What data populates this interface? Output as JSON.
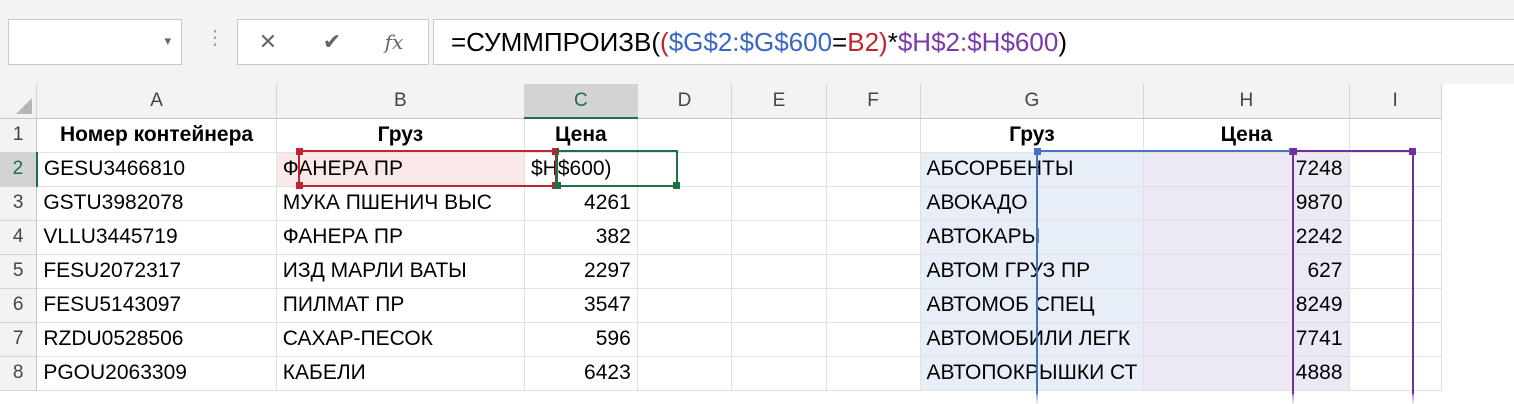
{
  "name_box": {
    "value": "",
    "dropdown_icon": "chevron-down-icon"
  },
  "formula_bar": {
    "cancel_icon": "✕",
    "enter_icon": "✔",
    "fx_label": "fx",
    "formula": {
      "p1": "=СУММПРОИЗВ(",
      "p2": "(",
      "p3": "$G$2:$G$600",
      "p4": "=",
      "p5": "B2",
      "p6": ")",
      "p7": "*",
      "p8": "$H$2:$H$600",
      "p9": ")"
    }
  },
  "columns": [
    "A",
    "B",
    "C",
    "D",
    "E",
    "F",
    "G",
    "H",
    "I"
  ],
  "rows": [
    {
      "num": "1",
      "a": "Номер контейнера",
      "b": "Груз",
      "c": "Цена",
      "g": "Груз",
      "h": "Цена"
    },
    {
      "num": "2",
      "a": "GESU3466810",
      "b": "ФАНЕРА ПР",
      "c": "$H$600)",
      "g": "АБСОРБЕНТЫ",
      "h": "7248"
    },
    {
      "num": "3",
      "a": "GSTU3982078",
      "b": "МУКА ПШЕНИЧ ВЫС",
      "c": "4261",
      "g": "АВОКАДО",
      "h": "9870"
    },
    {
      "num": "4",
      "a": "VLLU3445719",
      "b": "ФАНЕРА ПР",
      "c": "382",
      "g": "АВТОКАРЫ",
      "h": "2242"
    },
    {
      "num": "5",
      "a": "FESU2072317",
      "b": "ИЗД МАРЛИ ВАТЫ",
      "c": "2297",
      "g": "АВТОМ ГРУЗ ПР",
      "h": "627"
    },
    {
      "num": "6",
      "a": "FESU5143097",
      "b": "ПИЛМАТ ПР",
      "c": "3547",
      "g": "АВТОМОБ СПЕЦ",
      "h": "8249"
    },
    {
      "num": "7",
      "a": "RZDU0528506",
      "b": "САХАР-ПЕСОК",
      "c": "596",
      "g": "АВТОМОБИЛИ ЛЕГК",
      "h": "7741"
    },
    {
      "num": "8",
      "a": "PGOU2063309",
      "b": "КАБЕЛИ",
      "c": "6423",
      "g": "АВТОПОКРЫШКИ СТ",
      "h": "4888"
    }
  ],
  "colors": {
    "active_cell": "#1e7145",
    "ref_b2": "#c0252f",
    "ref_g": "#4472c4",
    "ref_h": "#7030a0"
  }
}
